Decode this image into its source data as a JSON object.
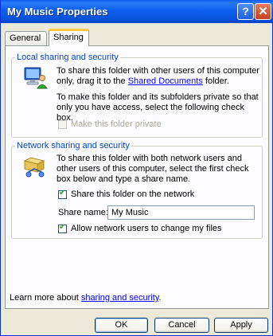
{
  "window": {
    "title": "My Music Properties",
    "help_glyph": "?",
    "close_glyph": "✕"
  },
  "tabs": [
    {
      "label": "General",
      "selected": false
    },
    {
      "label": "Sharing",
      "selected": true
    }
  ],
  "local": {
    "label": "Local sharing and security",
    "text1_pre": "To share this folder with other users of this computer only, drag it to the ",
    "text1_link": "Shared Documents",
    "text1_post": " folder.",
    "text2": "To make this folder and its subfolders private so that only you have access, select the following check box.",
    "private_label": "Make this folder private",
    "private_checked": false,
    "private_enabled": false
  },
  "network": {
    "label": "Network sharing and security",
    "text": "To share this folder with both network users and other users of this computer, select the first check box below and type a share name.",
    "share_label": "Share this folder on the network",
    "share_checked": true,
    "share_name_label": "Share name:",
    "share_name_value": "My Music",
    "allow_label": "Allow network users to change my files",
    "allow_checked": true
  },
  "learn_more": {
    "prefix": "Learn more about ",
    "link": "sharing and security",
    "suffix": "."
  },
  "buttons": {
    "ok": "OK",
    "cancel": "Cancel",
    "apply": "Apply"
  },
  "colors": {
    "titlebar": "#0A5BF2",
    "group_label": "#0046D5",
    "link": "#0000FF",
    "face": "#ECE9D8"
  },
  "icons": {
    "local": "computer-users-icon",
    "network": "network-share-icon"
  }
}
